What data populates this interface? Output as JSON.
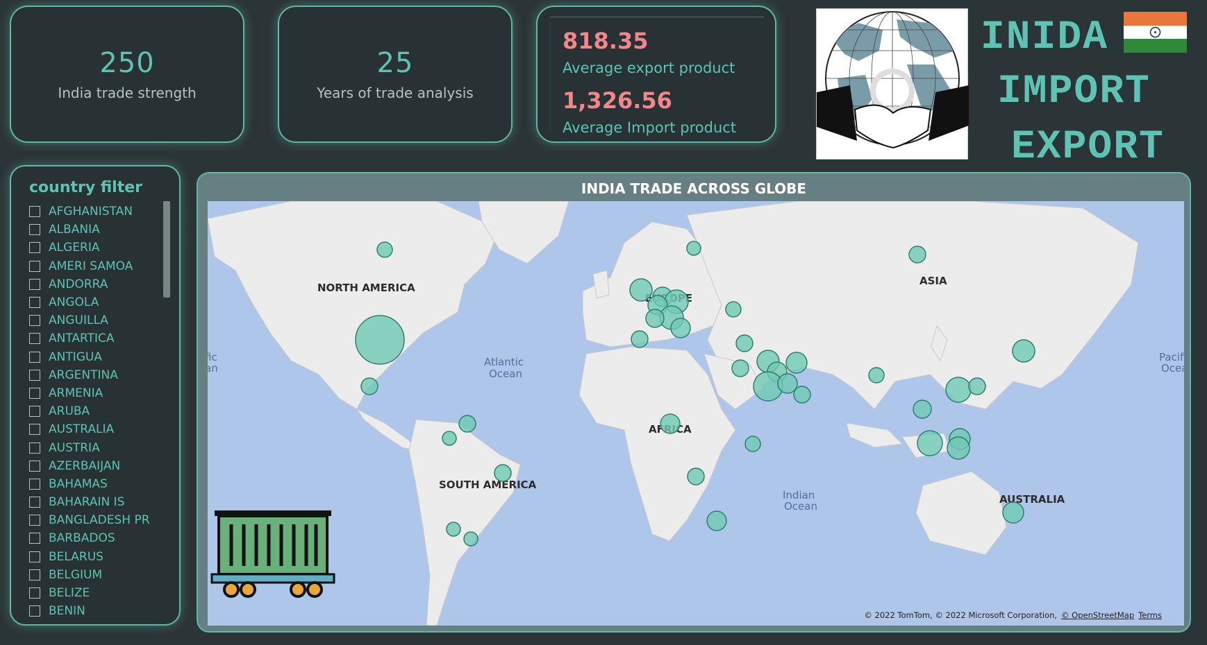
{
  "kpis": [
    {
      "value": "250",
      "label": "India trade strength"
    },
    {
      "value": "25",
      "label": "Years of trade analysis"
    }
  ],
  "averages": {
    "export_value": "818.35",
    "export_label": "Average export product",
    "import_value": "1,326.56",
    "import_label": "Average Import product"
  },
  "title": {
    "line1": "INIDA",
    "line2": "IMPORT",
    "line3": "EXPORT"
  },
  "flag_colors": {
    "top": "#e9773b",
    "middle": "#ffffff",
    "bottom": "#2e8a3a",
    "chakra": "#1c2a6b"
  },
  "filter": {
    "title": "country filter",
    "items": [
      "AFGHANISTAN",
      "ALBANIA",
      "ALGERIA",
      "AMERI SAMOA",
      "ANDORRA",
      "ANGOLA",
      "ANGUILLA",
      "ANTARTICA",
      "ANTIGUA",
      "ARGENTINA",
      "ARMENIA",
      "ARUBA",
      "AUSTRALIA",
      "AUSTRIA",
      "AZERBAIJAN",
      "BAHAMAS",
      "BAHARAIN IS",
      "BANGLADESH PR",
      "BARBADOS",
      "BELARUS",
      "BELGIUM",
      "BELIZE",
      "BENIN"
    ]
  },
  "map": {
    "title": "INDIA TRADE ACROSS GLOBE",
    "continents": [
      "NORTH AMERICA",
      "EUROPE",
      "ASIA",
      "AFRICA",
      "SOUTH AMERICA",
      "AUSTRALIA"
    ],
    "oceans": [
      "Atlantic",
      "Ocean",
      "Indian",
      "Ocean",
      "Pacific",
      "Ocean",
      "fic",
      "an"
    ],
    "attribution": [
      "© 2022 TomTom, © 2022 Microsoft Corporation,",
      "© OpenStreetMap",
      "Terms"
    ],
    "bubble_color": "#6fc9b4",
    "bubble_border": "#2f7f6c"
  }
}
